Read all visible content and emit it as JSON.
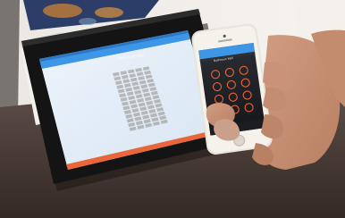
{
  "tablet": {
    "screen_title": "Bathroom Wall",
    "header_color": "#3d96e6",
    "footer_color": "#e8663a",
    "grid_rows": 14,
    "grid_cols": 5
  },
  "phone": {
    "screen_title": "Bathroom Wall",
    "header_color": "#3d96e6",
    "keypad_color": "#e8663a",
    "keypad_rows": 4,
    "keypad_cols": 3
  },
  "colors": {
    "table": "#463a36",
    "wall": "#ede9e4",
    "tablet_bezel": "#141414",
    "phone_body": "#e9e3da",
    "hand": "#d8a588"
  }
}
